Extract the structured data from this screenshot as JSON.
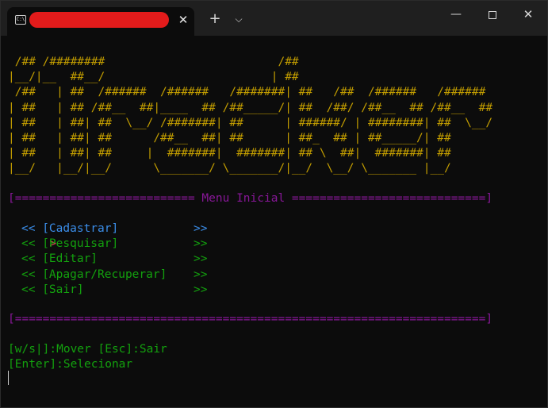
{
  "window": {
    "new_tab_label": "+",
    "dropdown_label": "⌵",
    "tab_icon_label": "C:\\",
    "tab_close_label": "✕",
    "min_label": "—",
    "close_label": "✕"
  },
  "banner": {
    "lines": [
      " /## /########                         /##",
      "|__/|__  ##__/                        | ##",
      " /##   | ##  /######  /######   /#######| ##   /##  /######   /######",
      "| ##   | ## /##__  ##|____  ## /##_____/| ##  /##/ /##__  ## /##__  ##",
      "| ##   | ##| ##  \\__/ /#######| ##      | ######/ | ########| ##  \\__/",
      "| ##   | ##| ##      /##__  ##| ##      | ##_  ## | ##_____/| ##",
      "| ##   | ##| ##     |  #######|  #######| ## \\  ##|  #######| ##",
      "|__/   |__/|__/      \\_______/ \\_______/|__/  \\__/ \\_______ |__/"
    ]
  },
  "menu": {
    "header": "[========================== Menu Inicial ============================]",
    "pointer": ">",
    "items": [
      {
        "left": "<< [Cadastrar]",
        "right": ">>"
      },
      {
        "left": "<< [Pesquisar]",
        "right": ">>"
      },
      {
        "left": "<< [Editar]",
        "right": ">>"
      },
      {
        "left": "<< [Apagar/Recuperar]",
        "right": ">>"
      },
      {
        "left": "<< [Sair]",
        "right": ">>"
      }
    ],
    "footer": "[====================================================================]"
  },
  "help": {
    "line1": "[w/s|]:Mover [Esc]:Sair",
    "line2": "[Enter]:Selecionar"
  },
  "colors": {
    "banner": "#c19c00",
    "menu_rule": "#881798",
    "item": "#13a10e",
    "item_selected": "#3b8eea",
    "pointer": "#e74856"
  }
}
